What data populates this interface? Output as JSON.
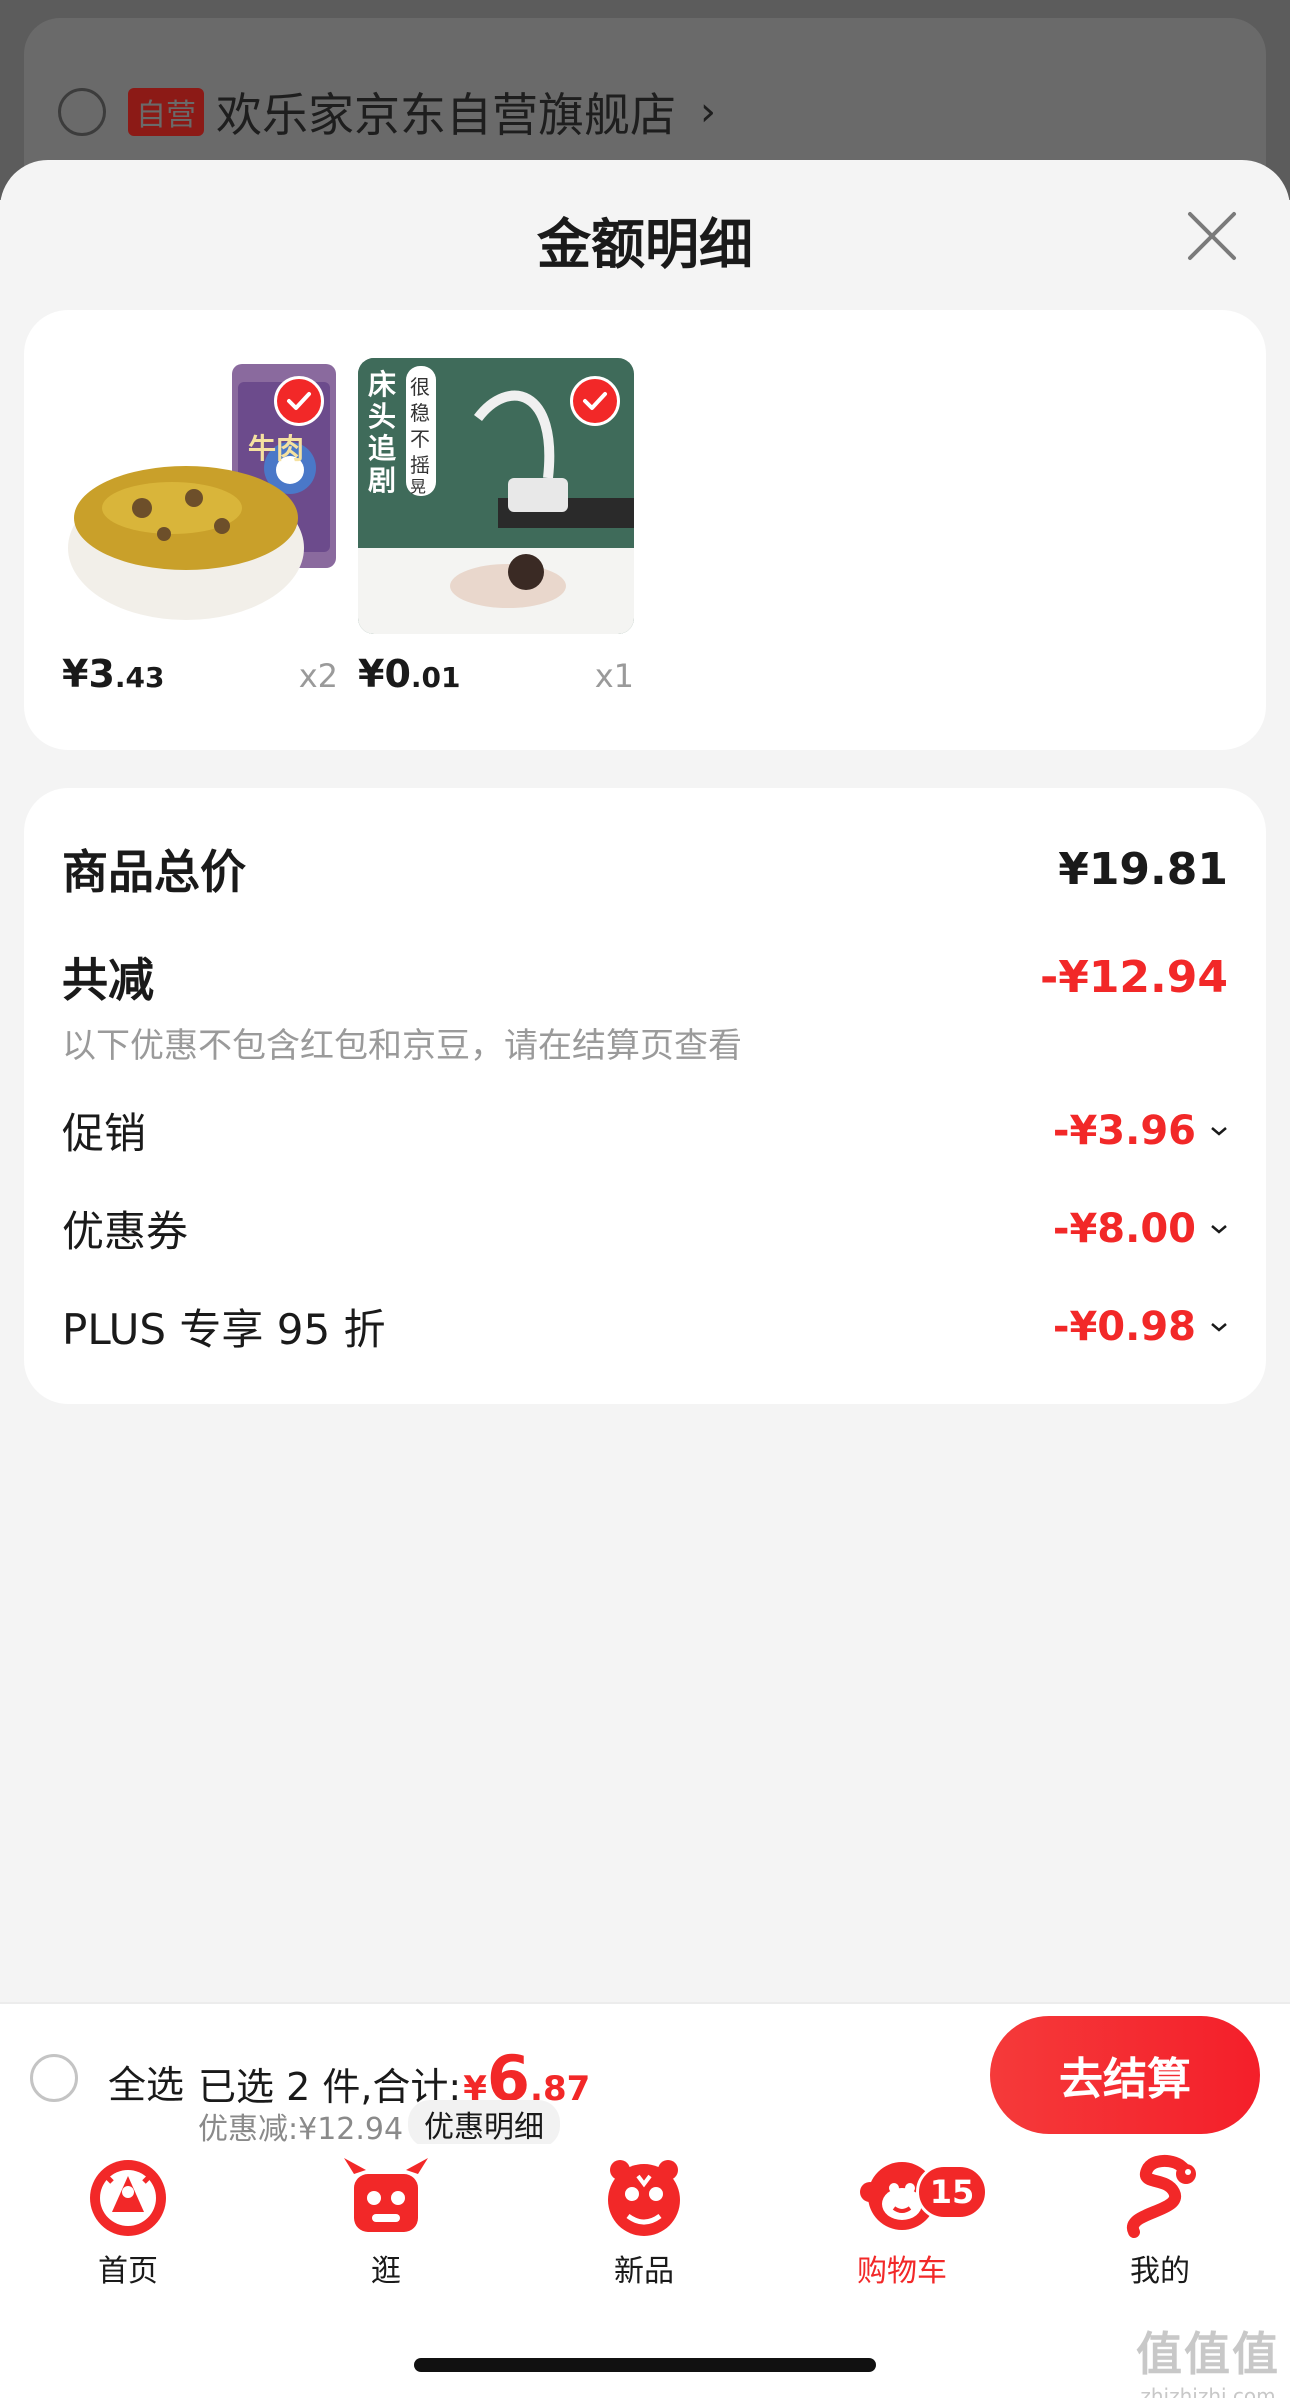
{
  "background_store": {
    "tag": "自营",
    "name": "欢乐家京东自营旗舰店",
    "chevron": "›"
  },
  "sheet": {
    "title": "金额明细"
  },
  "products": [
    {
      "price_int": "¥3",
      "price_dec": ".43",
      "qty": "x2",
      "image_icon": "food-jar-image",
      "overlay_text": "牛肉"
    },
    {
      "price_int": "¥0",
      "price_dec": ".01",
      "qty": "x1",
      "image_icon": "phone-holder-image",
      "overlay_text": [
        "床头追剧",
        "很稳不摇晃"
      ]
    }
  ],
  "summary": {
    "total_label": "商品总价",
    "total_value": "¥19.81",
    "reduce_label": "共减",
    "reduce_value": "-¥12.94",
    "reduce_note": "以下优惠不包含红包和京豆，请在结算页查看",
    "items": [
      {
        "label": "促销",
        "value": "-¥3.96"
      },
      {
        "label": "优惠券",
        "value": "-¥8.00"
      },
      {
        "label": "PLUS 专享 95 折",
        "value": "-¥0.98"
      }
    ]
  },
  "checkout": {
    "select_all": "全选",
    "selected_prefix": "已选 2 件,合计:",
    "currency": "¥",
    "total_int": "6",
    "total_dec": ".87",
    "discount": "优惠减:¥12.94",
    "discount_detail": "优惠明细",
    "button": "去结算"
  },
  "tabbar": {
    "tabs": [
      {
        "label": "首页",
        "icon": "papercut-rooster-icon"
      },
      {
        "label": "逛",
        "icon": "papercut-ox-icon"
      },
      {
        "label": "新品",
        "icon": "papercut-tiger-icon"
      },
      {
        "label": "购物车",
        "icon": "papercut-monkey-icon",
        "active": true,
        "badge": "15"
      },
      {
        "label": "我的",
        "icon": "papercut-dragon-icon"
      }
    ]
  },
  "watermark": {
    "logo": "值值值",
    "url": "zhizhizhi.com"
  },
  "colors": {
    "accent": "#f22828",
    "background": "#f4f4f4",
    "card": "#ffffff"
  }
}
